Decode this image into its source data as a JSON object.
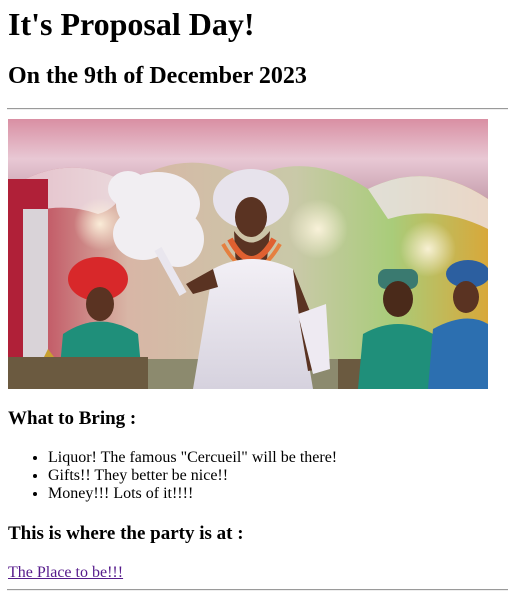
{
  "header": {
    "title": "It's Proposal Day!",
    "date_line": "On the 9th of December 2023"
  },
  "photo": {
    "subject": "celebration-photo",
    "colors": {
      "tent_pink": "#c98a9a",
      "tent_white": "#ece4ea",
      "dress_white": "#e9e6ee",
      "gele_red": "#d8282a",
      "wall_green": "#9cc06a",
      "guest_blue": "#2c6fb0",
      "guest_teal": "#1f8f7a"
    }
  },
  "bring": {
    "heading": "What to Bring :",
    "items": [
      "Liquor! The famous \"Cercueil\" will be there!",
      "Gifts!! They better be nice!!",
      "Money!!! Lots of it!!!!"
    ]
  },
  "party": {
    "heading": "This is where the party is at :",
    "link_label": "The Place to be!!!",
    "link_color": "#551a8b"
  }
}
